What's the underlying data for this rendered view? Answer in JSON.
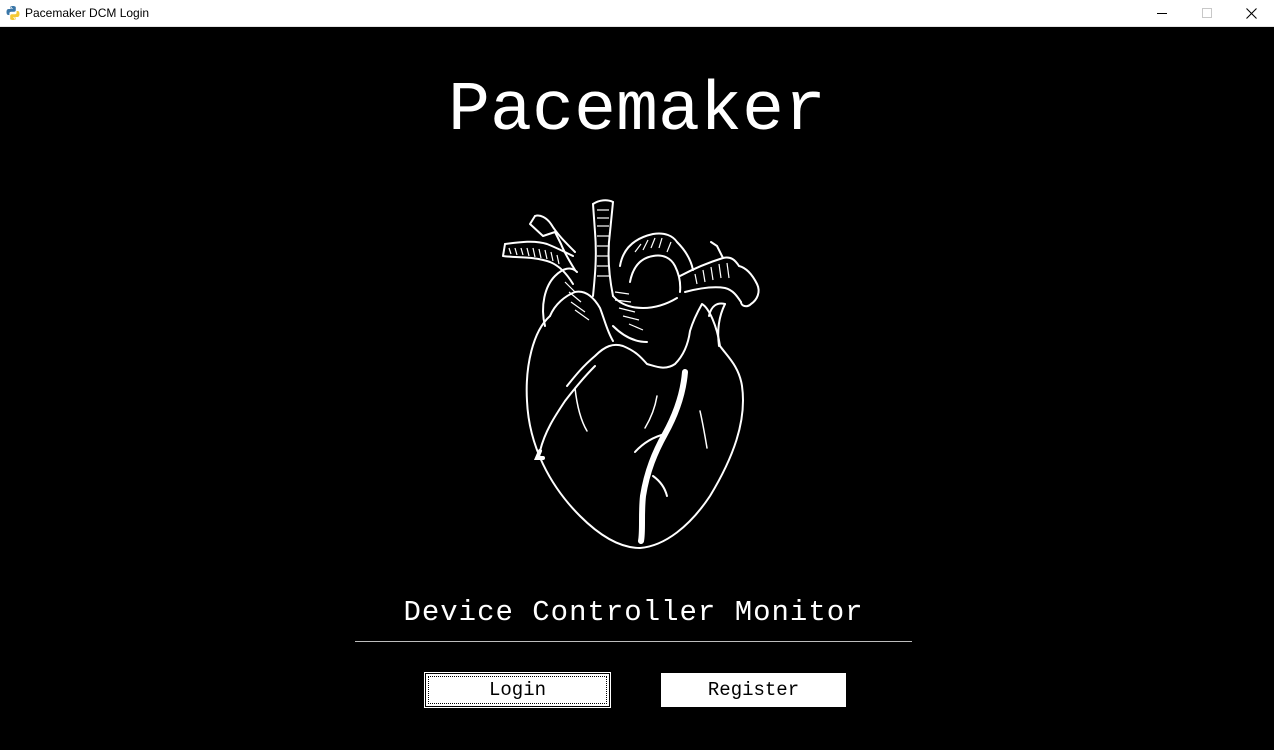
{
  "window": {
    "title": "Pacemaker DCM Login",
    "icon": "python-icon",
    "controls": [
      "minimize-icon",
      "maximize-icon",
      "close-icon"
    ]
  },
  "main": {
    "title": "Pacemaker",
    "image": "anatomical-heart-drawing",
    "subtitle": "Device Controller Monitor"
  },
  "buttons": {
    "login_label": "Login",
    "register_label": "Register"
  },
  "colors": {
    "background": "#000000",
    "text": "#ffffff",
    "button_bg": "#ffffff",
    "button_text": "#000000"
  }
}
